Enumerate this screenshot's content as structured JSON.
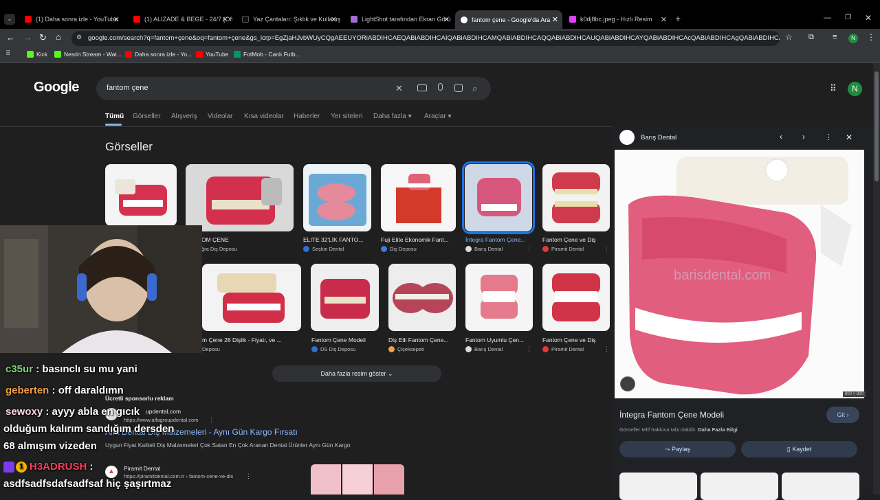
{
  "tabs": [
    {
      "label": "(1) Daha sonra izle - YouTube",
      "color": "#ff0000"
    },
    {
      "label": "(1) ALIZADE & BEGE - 24/7 (Offici",
      "color": "#ff0000"
    },
    {
      "label": "Yaz Çantaları: Şıklık ve Kullanışlı",
      "color": "#222222"
    },
    {
      "label": "LightShot tarafından Ekran Görü",
      "color": "#a06cd5"
    },
    {
      "label": "fantom çene - Google'da Ara",
      "color": "#4285f4"
    },
    {
      "label": "k0dj8bc.jpeg - Hızlı Resim",
      "color": "#e040fb"
    }
  ],
  "address": "google.com/search?q=fantom+çene&oq=fantom+çene&gs_lcrp=EgZjaHJvbWUyCQgAEEUYORiABDIHCAEQABiABDIHCAIQABiABDIHCAMQABiABDIHCAQQABiABDIHCAUQABiABDIHCAYQABiABDIHCAcQABiABDIHCAgQABiABDIHCAkQABiABNI...",
  "bookmarks": [
    {
      "label": "Kick",
      "color": "#53fc18"
    },
    {
      "label": "Nesrin Stream - Wat...",
      "color": "#53fc18"
    },
    {
      "label": "Daha sonra izle - Yo...",
      "color": "#ff0000"
    },
    {
      "label": "YouTube",
      "color": "#ff0000"
    },
    {
      "label": "FotMob - Canlı Futb...",
      "color": "#00985f"
    }
  ],
  "profile_initial": "N",
  "logo": "Google",
  "search_query": "fantom çene",
  "nav": [
    "Tümü",
    "Görseller",
    "Alışveriş",
    "Videolar",
    "Kısa videolar",
    "Haberler",
    "Yer siteleri",
    "Daha fazla",
    "Araçlar"
  ],
  "images_heading": "Görseller",
  "row1": [
    {
      "title": "",
      "source": ""
    },
    {
      "title": "OM ÇENE",
      "source": "ğra Diş Deposu"
    },
    {
      "title": "ELITE 32'LİK FANTO...",
      "source": "Seçkin Dental"
    },
    {
      "title": "Fuji Elite Ekonomik Fant...",
      "source": "Diş Deposu"
    },
    {
      "title": "İntegra Fantom Çene...",
      "source": "Barış Dental"
    },
    {
      "title": "Fantom Çene ve Diş",
      "source": "Piramit Dental"
    }
  ],
  "row2": [
    {
      "title": "m Çene 28 Dişlik - Fiyatı, ve ...",
      "source": "Deposu"
    },
    {
      "title": "Fantom Çene Modeli",
      "source": "DS Diş Deposu"
    },
    {
      "title": "Diş Etli Fantom Çene...",
      "source": "Çiçeksepeti"
    },
    {
      "title": "Fantom Uyumlu Çen...",
      "source": "Barış Dental"
    },
    {
      "title": "Fantom Çene ve Diş",
      "source": "Piramit Dental"
    }
  ],
  "more_images": "Daha fazla resim göster",
  "ad": {
    "label": "Ücretli sponsorlu reklam",
    "domain": "updental.com",
    "url": "https://www.alfagroupdental.com",
    "title": "Alfa Dental Diş Malzemeleri - Aynı Gün Kargo Fırsatı",
    "desc": "Uygun Fiyat Kaliteli Diş Malzemeleri Çok Satan En Çok Aranan Dental Ürünler Aynı Gün Kargo"
  },
  "result2": {
    "name": "Piramit Dental",
    "url": "https://piramitdental.com.tr › fantom-cene-ve-dis"
  },
  "panel": {
    "source": "Barış Dental",
    "watermark": "barisdental.com",
    "dimensions": "800 × 800",
    "title": "İntegra Fantom Çene Modeli",
    "go": "Git",
    "note": "Görseller telif hakkına tabi olabilir.",
    "note_link": "Daha Fazla Bilgi",
    "share": "Paylaş",
    "save": "Kaydet"
  },
  "chat": [
    {
      "user": "c35ur",
      "color": "#7fd17a",
      "msg": " : basınclı su mu yani"
    },
    {
      "user": "geberten",
      "color": "#f0a14a",
      "msg": " : off daraldımn"
    },
    {
      "user": "sewoxy",
      "color": "#ffd6e0",
      "msg": " : ayyy abla en gıcık"
    },
    {
      "user": "",
      "color": "#ffffff",
      "msg": "olduğum kalırım sandığım dersden"
    },
    {
      "user": "",
      "color": "#ffffff",
      "msg": "68 almışım vizeden"
    },
    {
      "user": "H3ADRUSH",
      "color": "#ff3b5c",
      "msg": " :"
    },
    {
      "user": "",
      "color": "#ffffff",
      "msg": "asdfsadfsdafsadfsaf hiç şaşırtmaz"
    }
  ]
}
